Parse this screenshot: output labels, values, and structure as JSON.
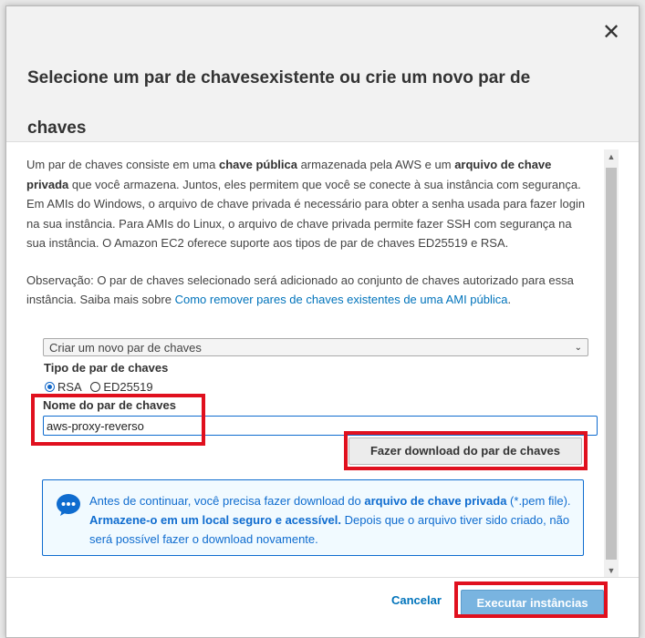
{
  "dialog": {
    "title": "Selecione um par de chavesexistente ou crie um novo par de chaves",
    "close_glyph": "✕"
  },
  "body": {
    "p1": [
      "Um par de chaves consiste em uma ",
      "chave pública",
      " armazenada pela AWS e um ",
      "arquivo de chave privada",
      " que você armazena. Juntos, eles permitem que você se conecte à sua instância com segurança. Em AMIs do Windows, o arquivo de chave privada é necessário para obter a senha usada para fazer login na sua instância. Para AMIs do Linux, o arquivo de chave privada permite fazer SSH com segurança na sua instância. O Amazon EC2 oferece suporte aos tipos de par de chaves ED25519 e RSA."
    ],
    "note_text": "Observação: O par de chaves selecionado será adicionado ao conjunto de chaves autorizado para essa instância. Saiba mais sobre ",
    "note_link": "Como remover pares de chaves existentes de uma AMI pública",
    "note_end": "."
  },
  "form": {
    "select_value": "Criar um novo par de chaves",
    "type_label": "Tipo de par de chaves",
    "types": [
      {
        "label": "RSA",
        "checked": true
      },
      {
        "label": "ED25519",
        "checked": false
      }
    ],
    "name_label": "Nome do par de chaves",
    "name_value": "aws-proxy-reverso",
    "download_label": "Fazer download do par de chaves"
  },
  "info": {
    "t1": "Antes de continuar, você precisa fazer download do ",
    "t2": "arquivo de chave privada",
    "t3": " (*.pem file). ",
    "t4": "Armazene-o em um local seguro e acessível.",
    "t5": " Depois que o arquivo tiver sido criado, não será possível fazer o download novamente."
  },
  "footer": {
    "cancel_label": "Cancelar",
    "run_label": "Executar instâncias"
  },
  "colors": {
    "highlight": "#e0101e",
    "link": "#0073bb",
    "info_blue": "#0f6ccf",
    "primary_button": "#79b4e0"
  }
}
